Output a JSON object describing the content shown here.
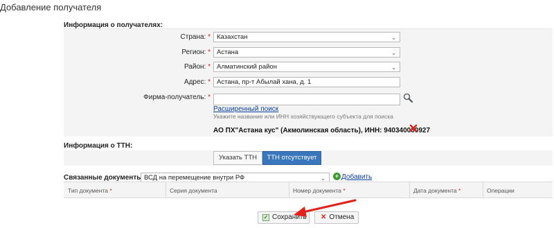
{
  "page": {
    "title": "Добавление получателя"
  },
  "recipient_section": {
    "title": "Информация о получателях:",
    "required_mark": "*",
    "country": {
      "label": "Страна:",
      "value": "Казахстан"
    },
    "region": {
      "label": "Регион:",
      "value": "Астана"
    },
    "district": {
      "label": "Район:",
      "value": "Алматинский район"
    },
    "address": {
      "label": "Адрес:",
      "value": "Астана, пр-т Абылай хана, д. 1"
    },
    "firm": {
      "label": "Фирма-получатель:",
      "value": "",
      "advanced_search_link": "Расширенный поиск",
      "hint": "Укажите название или ИНН хозяйствующего субъекта для поиска",
      "selected": "АО ПХ\"Астана кус\" (Акмолинская область), ИНН: 940340000927"
    }
  },
  "ttn_section": {
    "title": "Информация о ТТН:",
    "tabs": [
      {
        "label": "Указать ТТН",
        "active": false
      },
      {
        "label": "ТТН отсутствует",
        "active": true
      }
    ]
  },
  "related_docs": {
    "label": "Связанные документы:",
    "select_value": "ВСД на перемещение внутри РФ",
    "add_link": "Добавить",
    "columns": [
      {
        "label": "Тип документа",
        "required": true
      },
      {
        "label": "Серия документа",
        "required": false
      },
      {
        "label": "Номер документа",
        "required": true
      },
      {
        "label": "Дата документа",
        "required": true
      },
      {
        "label": "Операции",
        "required": false
      }
    ]
  },
  "actions": {
    "save_label": "Сохранить",
    "cancel_label": "Отмена"
  },
  "colors": {
    "accent": "#3a76bb",
    "required": "#d9261c",
    "link": "#0a3d9c",
    "arrow": "#e0231c",
    "add": "#3f9a2f"
  },
  "icons": {
    "search": "magnifier-icon",
    "remove": "red-x-icon",
    "add": "green-plus-icon",
    "save": "checkmark-icon",
    "cancel": "red-x-icon",
    "arrow": "red-arrow-annotation"
  }
}
